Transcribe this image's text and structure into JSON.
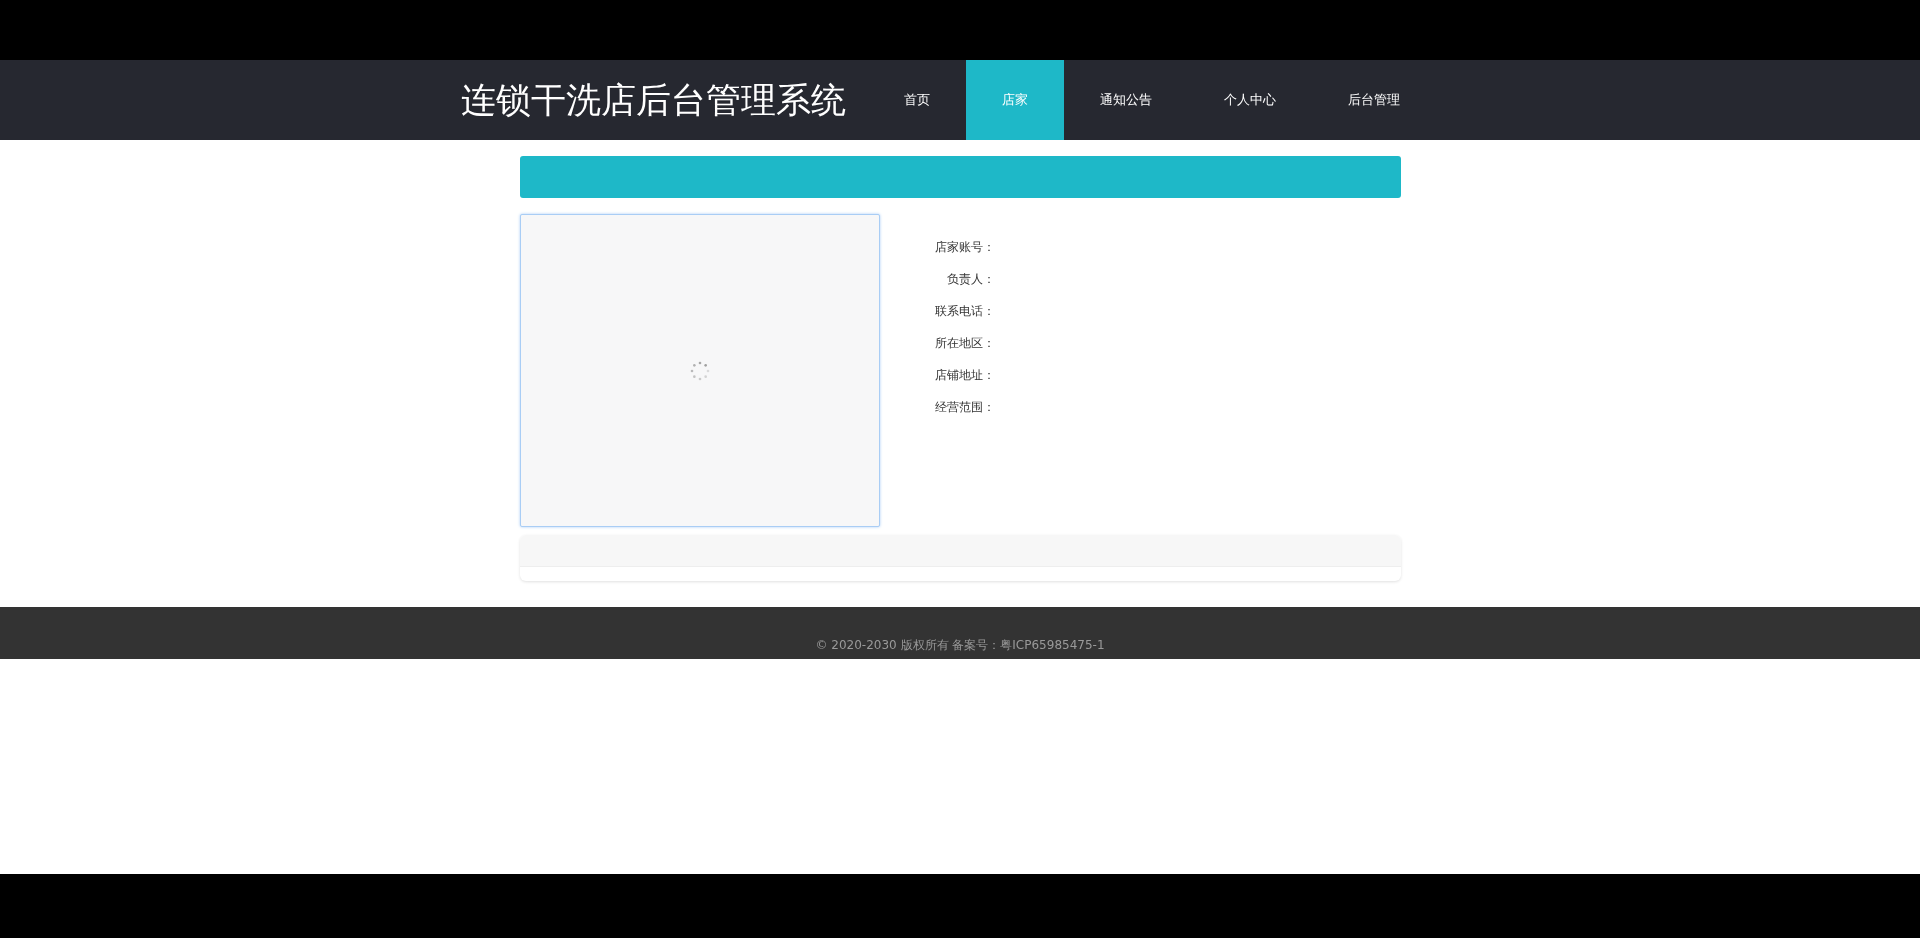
{
  "header": {
    "title": "连锁干洗店后台管理系统"
  },
  "nav": [
    {
      "label": "首页",
      "selected": false
    },
    {
      "label": "店家",
      "selected": true
    },
    {
      "label": "通知公告",
      "selected": false
    },
    {
      "label": "个人中心",
      "selected": false
    },
    {
      "label": "后台管理",
      "selected": false
    }
  ],
  "details": {
    "image": {
      "loading": true
    },
    "fields": [
      {
        "label": "店家账号："
      },
      {
        "label": "负责人："
      },
      {
        "label": "联系电话："
      },
      {
        "label": "所在地区："
      },
      {
        "label": "店铺地址："
      },
      {
        "label": "经营范围："
      }
    ]
  },
  "footer": {
    "copyright": "© 2020-2030 版权所有 备案号：粤ICP65985475-1"
  }
}
